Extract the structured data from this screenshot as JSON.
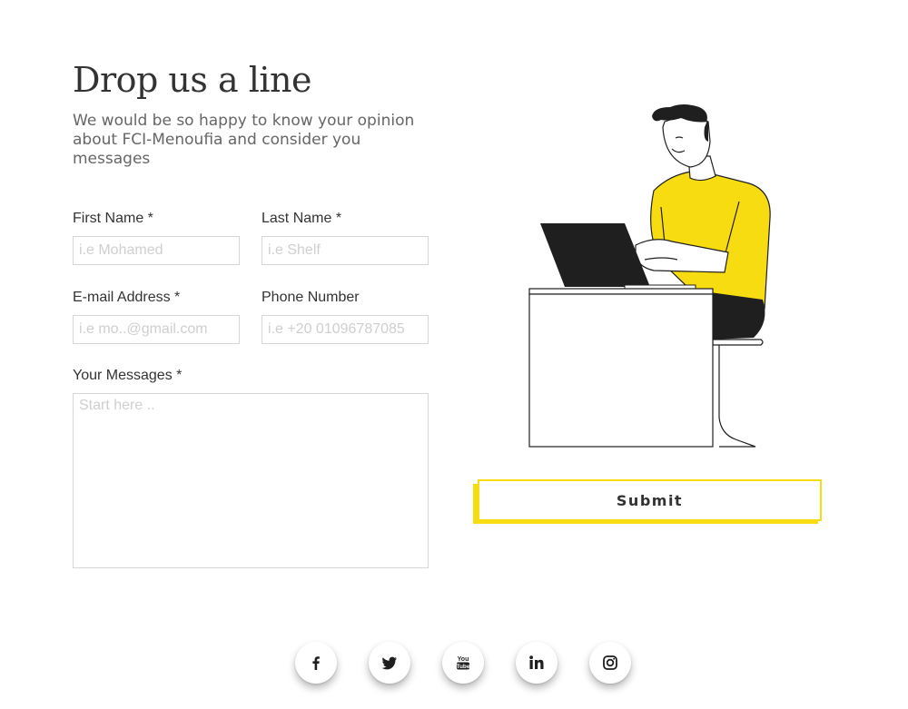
{
  "heading": {
    "title": "Drop us a line",
    "subtitle": "We would be so happy to know your opinion about FCI-Menoufia and consider you messages"
  },
  "form": {
    "first_name": {
      "label": "First Name *",
      "placeholder": "i.e Mohamed",
      "value": ""
    },
    "last_name": {
      "label": "Last Name *",
      "placeholder": "i.e Shelf",
      "value": ""
    },
    "email": {
      "label": "E-mail Address *",
      "placeholder": "i.e mo..@gmail.com",
      "value": ""
    },
    "phone": {
      "label": "Phone Number",
      "placeholder": "i.e +20 01096787085",
      "value": ""
    },
    "message": {
      "label": "Your Messages *",
      "placeholder": "Start here ..",
      "value": ""
    },
    "submit_label": "Submit"
  },
  "social": [
    {
      "name": "facebook-icon"
    },
    {
      "name": "twitter-icon"
    },
    {
      "name": "youtube-icon"
    },
    {
      "name": "linkedin-icon"
    },
    {
      "name": "instagram-icon"
    }
  ],
  "colors": {
    "accent": "#f7dc12",
    "text": "#333333",
    "muted": "#666666",
    "border": "#d6d6d6",
    "placeholder": "#cfcfcf",
    "illustration_dark": "#1f1f1f"
  },
  "illustration": {
    "name": "man-working-at-laptop-illustration"
  }
}
